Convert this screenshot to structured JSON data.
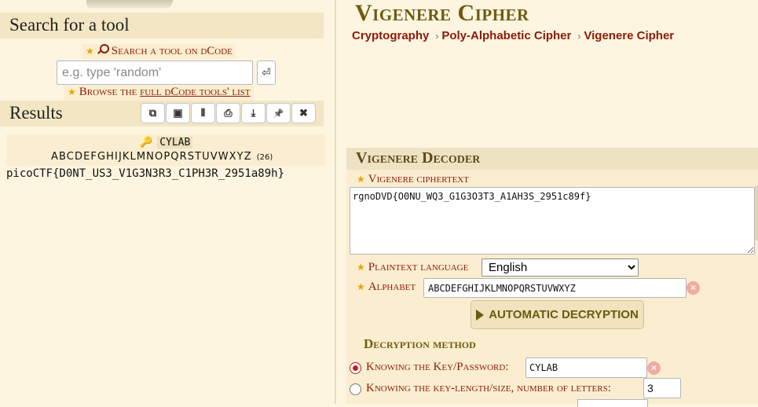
{
  "left": {
    "search_heading": "Search for a tool",
    "search_link": "Search a tool on dCode",
    "search_placeholder": "e.g. type 'random'",
    "search_go_symbol": "⏎",
    "browse_prefix": "Browse the ",
    "browse_link": "full dCode tools' list",
    "results_heading": "Results",
    "result_tools": [
      {
        "icon": "copy-icon",
        "symbol": "⧉"
      },
      {
        "icon": "save-icon",
        "symbol": "▣"
      },
      {
        "icon": "split-icon",
        "symbol": "⦀"
      },
      {
        "icon": "print-icon",
        "symbol": "⎙"
      },
      {
        "icon": "download-icon",
        "symbol": "⤓"
      },
      {
        "icon": "pin-icon",
        "symbol": "📌"
      },
      {
        "icon": "close-icon",
        "symbol": "✖"
      }
    ],
    "result_key": "CYLAB",
    "result_alphabet": "ABCDEFGHIJKLMNOPQRSTUVWXYZ",
    "result_alphabet_count": "(26)",
    "result_plaintext": "picoCTF{D0NT_US3_V1G3N3R3_C1PH3R_2951a89h}"
  },
  "right": {
    "title": "Vigenere Cipher",
    "breadcrumb": [
      "Cryptography",
      "Poly-Alphabetic Cipher",
      "Vigenere Cipher"
    ],
    "decoder_heading": "Vigenere Decoder",
    "ciphertext_label": "Vigenere ciphertext",
    "ciphertext_value": "rgnoDVD{O0NU_WQ3_G1G3O3T3_A1AH3S_2951c89f}",
    "language_label": "Plaintext language",
    "language_selected": "English",
    "alphabet_label": "Alphabet",
    "alphabet_value": "ABCDEFGHIJKLMNOPQRSTUVWXYZ",
    "auto_button": "AUTOMATIC DECRYPTION",
    "method_heading": "Decryption method",
    "method_key_label": "Knowing the Key/Password:",
    "method_key_value": "CYLAB",
    "method_len_label": "Knowing the key-length/size, number of letters:",
    "method_len_value": "3"
  },
  "colors": {
    "background": "#fdf5e0",
    "link_red": "#8b1a08",
    "title_olive": "#6e5b10",
    "star": "#e8a400"
  }
}
